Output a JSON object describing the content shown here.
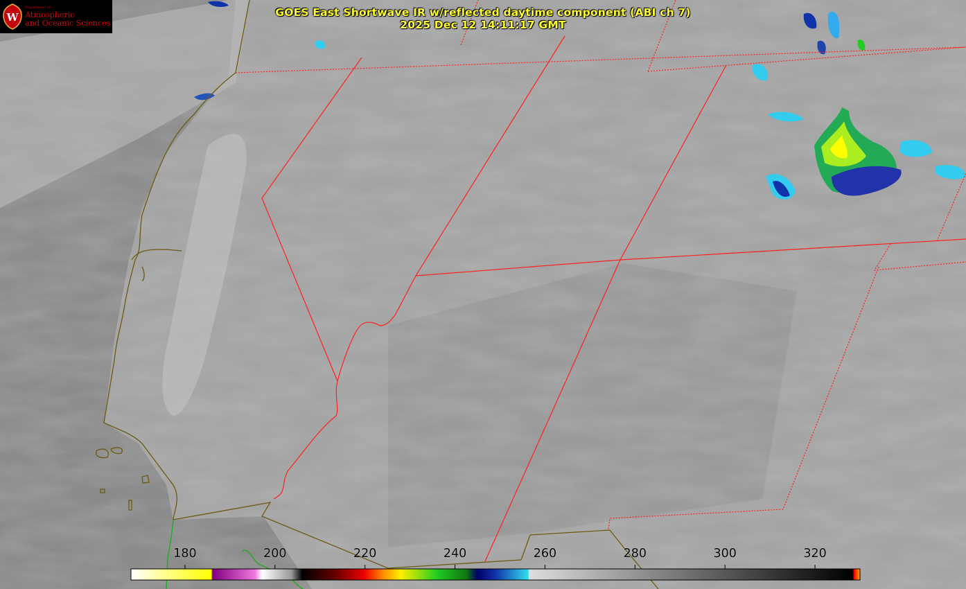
{
  "header": {
    "title_line1": "GOES East Shortwave IR w/reflected daytime component (ABI ch 7)",
    "title_line2": "2025 Dec 12 14:11:17 GMT"
  },
  "logo": {
    "dept": "Department of",
    "line1": "Atmospheric",
    "line2": "and Oceanic Sciences",
    "icon": "uw-crest-icon",
    "color": "#c5050c"
  },
  "colorbar": {
    "ticks": [
      "180",
      "200",
      "220",
      "240",
      "260",
      "280",
      "300",
      "320"
    ],
    "range": [
      168,
      330
    ]
  },
  "colors": {
    "title": "#ffff33",
    "state_borders": "#ff2020",
    "coastline": "#6b5a10",
    "cold_cloud_cyan": "#33ddee",
    "cold_cloud_green": "#22cc22",
    "cold_cloud_yellow": "#ffff00"
  }
}
